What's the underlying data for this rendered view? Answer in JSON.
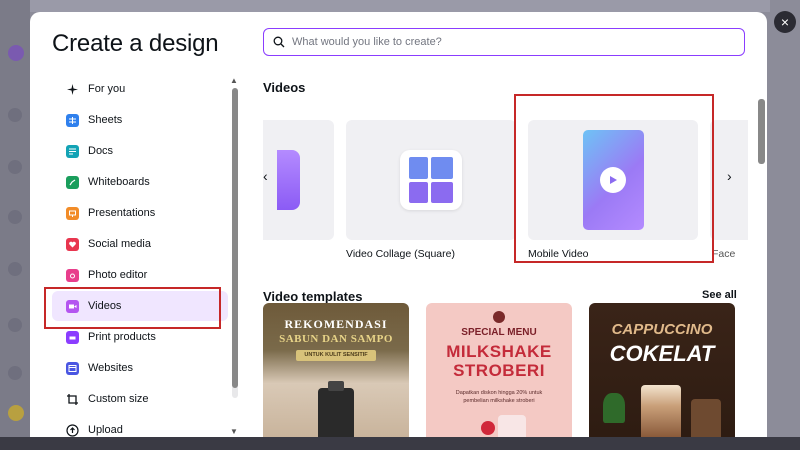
{
  "modal": {
    "title": "Create a design",
    "close_symbol": "×"
  },
  "search": {
    "placeholder": "What would you like to create?"
  },
  "sidebar": {
    "items": [
      {
        "label": "For you",
        "icon": "sparkle-icon",
        "color": "#0e1318"
      },
      {
        "label": "Sheets",
        "icon": "sheets-icon",
        "color": "#2f80ed"
      },
      {
        "label": "Docs",
        "icon": "docs-icon",
        "color": "#13a3b5"
      },
      {
        "label": "Whiteboards",
        "icon": "whiteboard-icon",
        "color": "#1a9e5c"
      },
      {
        "label": "Presentations",
        "icon": "presentation-icon",
        "color": "#f28c28"
      },
      {
        "label": "Social media",
        "icon": "heart-icon",
        "color": "#e8364f"
      },
      {
        "label": "Photo editor",
        "icon": "camera-icon",
        "color": "#e83e8c"
      },
      {
        "label": "Videos",
        "icon": "video-icon",
        "color": "#b455f0"
      },
      {
        "label": "Print products",
        "icon": "printer-icon",
        "color": "#8b3dff"
      },
      {
        "label": "Websites",
        "icon": "website-icon",
        "color": "#4a56e2"
      },
      {
        "label": "Custom size",
        "icon": "crop-icon",
        "color": "#0e1318"
      },
      {
        "label": "Upload",
        "icon": "upload-icon",
        "color": "#0e1318"
      }
    ],
    "active_index": 7
  },
  "videos_section": {
    "title": "Videos",
    "cards": [
      {
        "label": "Video Collage (Square)"
      },
      {
        "label": "Mobile Video"
      },
      {
        "label": "Face"
      }
    ]
  },
  "templates_section": {
    "title": "Video templates",
    "see_all": "See all",
    "templates": [
      {
        "line1": "REKOMENDASI",
        "line2": "SABUN DAN SAMPO",
        "line3": "UNTUK KULIT SENSITIF"
      },
      {
        "line1": "SPECIAL MENU",
        "line2": "MILKSHAKE",
        "line3": "STROBERI",
        "line4": "Dapatkan diskon hingga 20% untuk",
        "line5": "pembelian milkshake stroberi"
      },
      {
        "line1": "CAPPUCCINO",
        "line2": "COKELAT"
      }
    ]
  },
  "colors": {
    "accent": "#8b3dff",
    "highlight": "#c62828",
    "active_bg": "#f0e6ff"
  }
}
